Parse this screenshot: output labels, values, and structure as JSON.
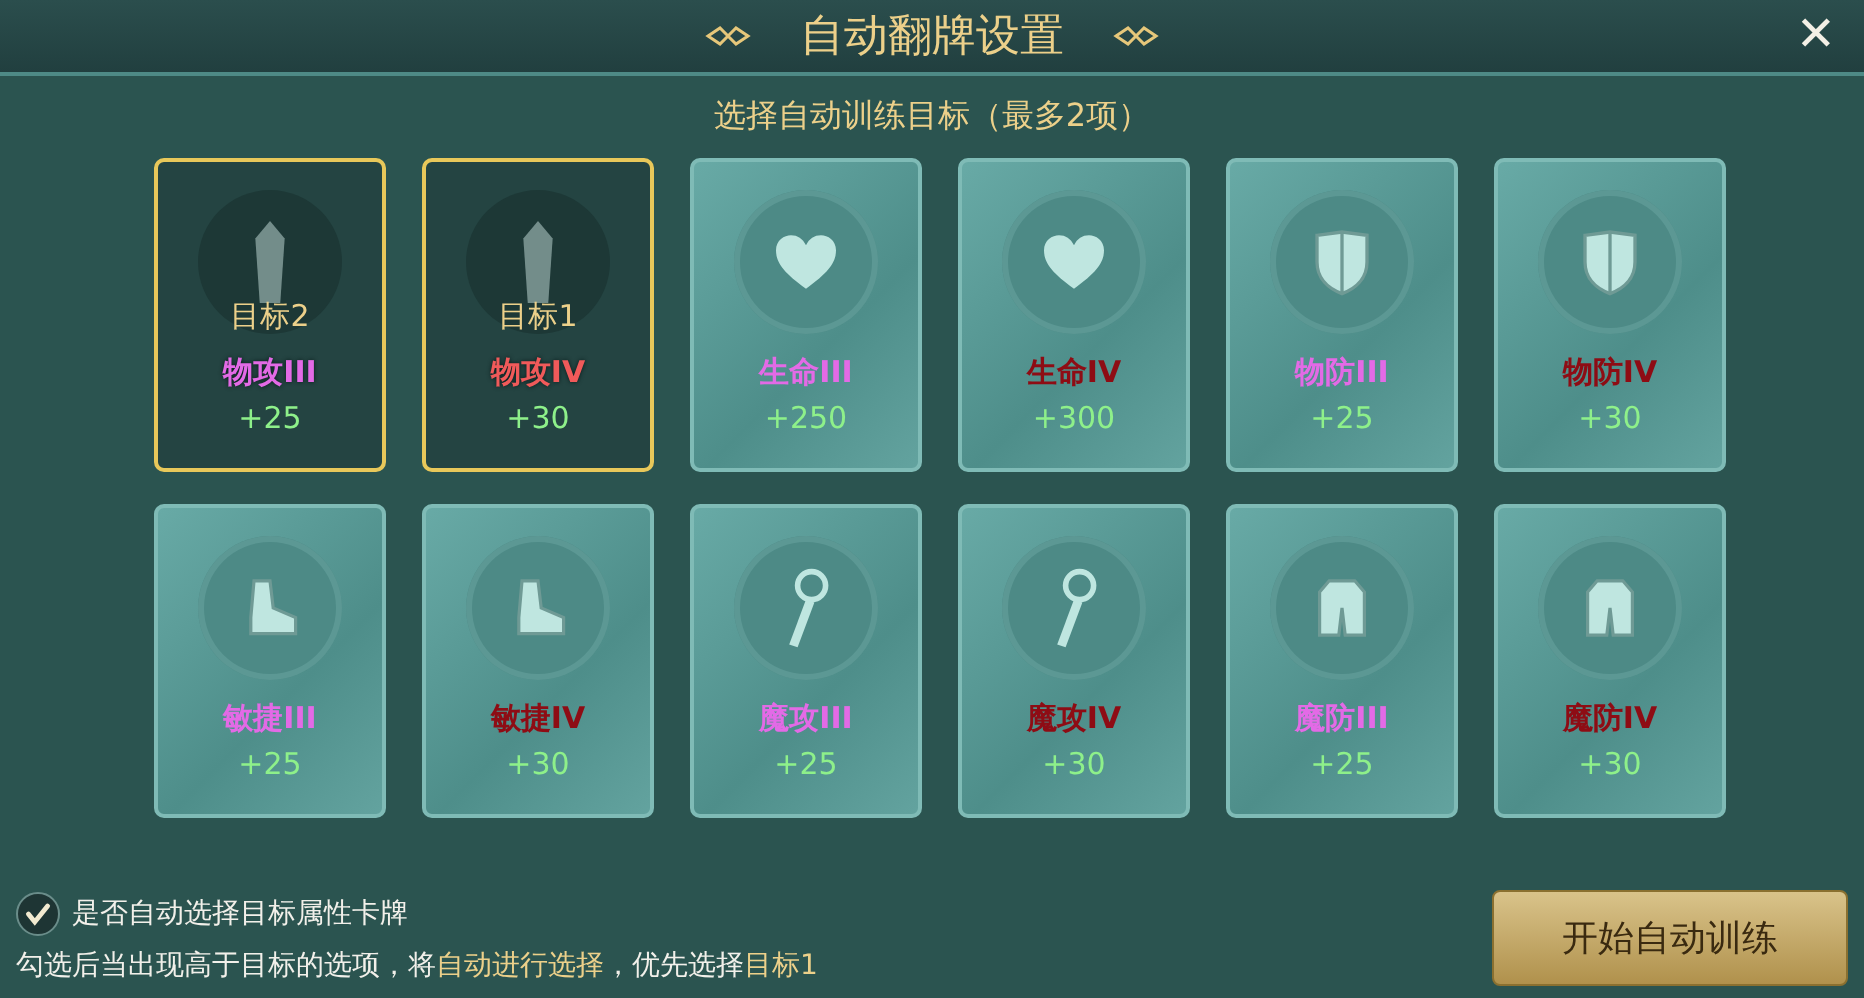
{
  "window": {
    "title": "自动翻牌设置",
    "close": "✕"
  },
  "subtitle": "选择自动训练目标（最多2项）",
  "cards": [
    {
      "kind": "sword",
      "name": "物攻III",
      "color": "#e36ae6",
      "value": "+25",
      "selected": true,
      "target": "目标2"
    },
    {
      "kind": "sword",
      "name": "物攻IV",
      "color": "#f05a5a",
      "value": "+30",
      "selected": true,
      "target": "目标1"
    },
    {
      "kind": "heart",
      "name": "生命III",
      "color": "#e36ae6",
      "value": "+250",
      "selected": false
    },
    {
      "kind": "heart",
      "name": "生命IV",
      "color": "#8e0c14",
      "value": "+300",
      "selected": false
    },
    {
      "kind": "shield",
      "name": "物防III",
      "color": "#e36ae6",
      "value": "+25",
      "selected": false
    },
    {
      "kind": "shield",
      "name": "物防IV",
      "color": "#8e0c14",
      "value": "+30",
      "selected": false
    },
    {
      "kind": "boot",
      "name": "敏捷III",
      "color": "#e36ae6",
      "value": "+25",
      "selected": false
    },
    {
      "kind": "boot",
      "name": "敏捷IV",
      "color": "#8e0c14",
      "value": "+30",
      "selected": false
    },
    {
      "kind": "wand",
      "name": "魔攻III",
      "color": "#e36ae6",
      "value": "+25",
      "selected": false
    },
    {
      "kind": "wand",
      "name": "魔攻IV",
      "color": "#8e0c14",
      "value": "+30",
      "selected": false
    },
    {
      "kind": "armor",
      "name": "魔防III",
      "color": "#e36ae6",
      "value": "+25",
      "selected": false
    },
    {
      "kind": "armor",
      "name": "魔防IV",
      "color": "#8e0c14",
      "value": "+30",
      "selected": false
    }
  ],
  "auto_select": {
    "label": "是否自动选择目标属性卡牌",
    "checked": true
  },
  "hint": [
    {
      "text": "勾选后当出现高于目标的选项，将",
      "highlight": false
    },
    {
      "text": "自动进行选择",
      "highlight": true
    },
    {
      "text": "，优先选择",
      "highlight": false
    },
    {
      "text": "目标1",
      "highlight": true
    }
  ],
  "start_button": "开始自动训练"
}
